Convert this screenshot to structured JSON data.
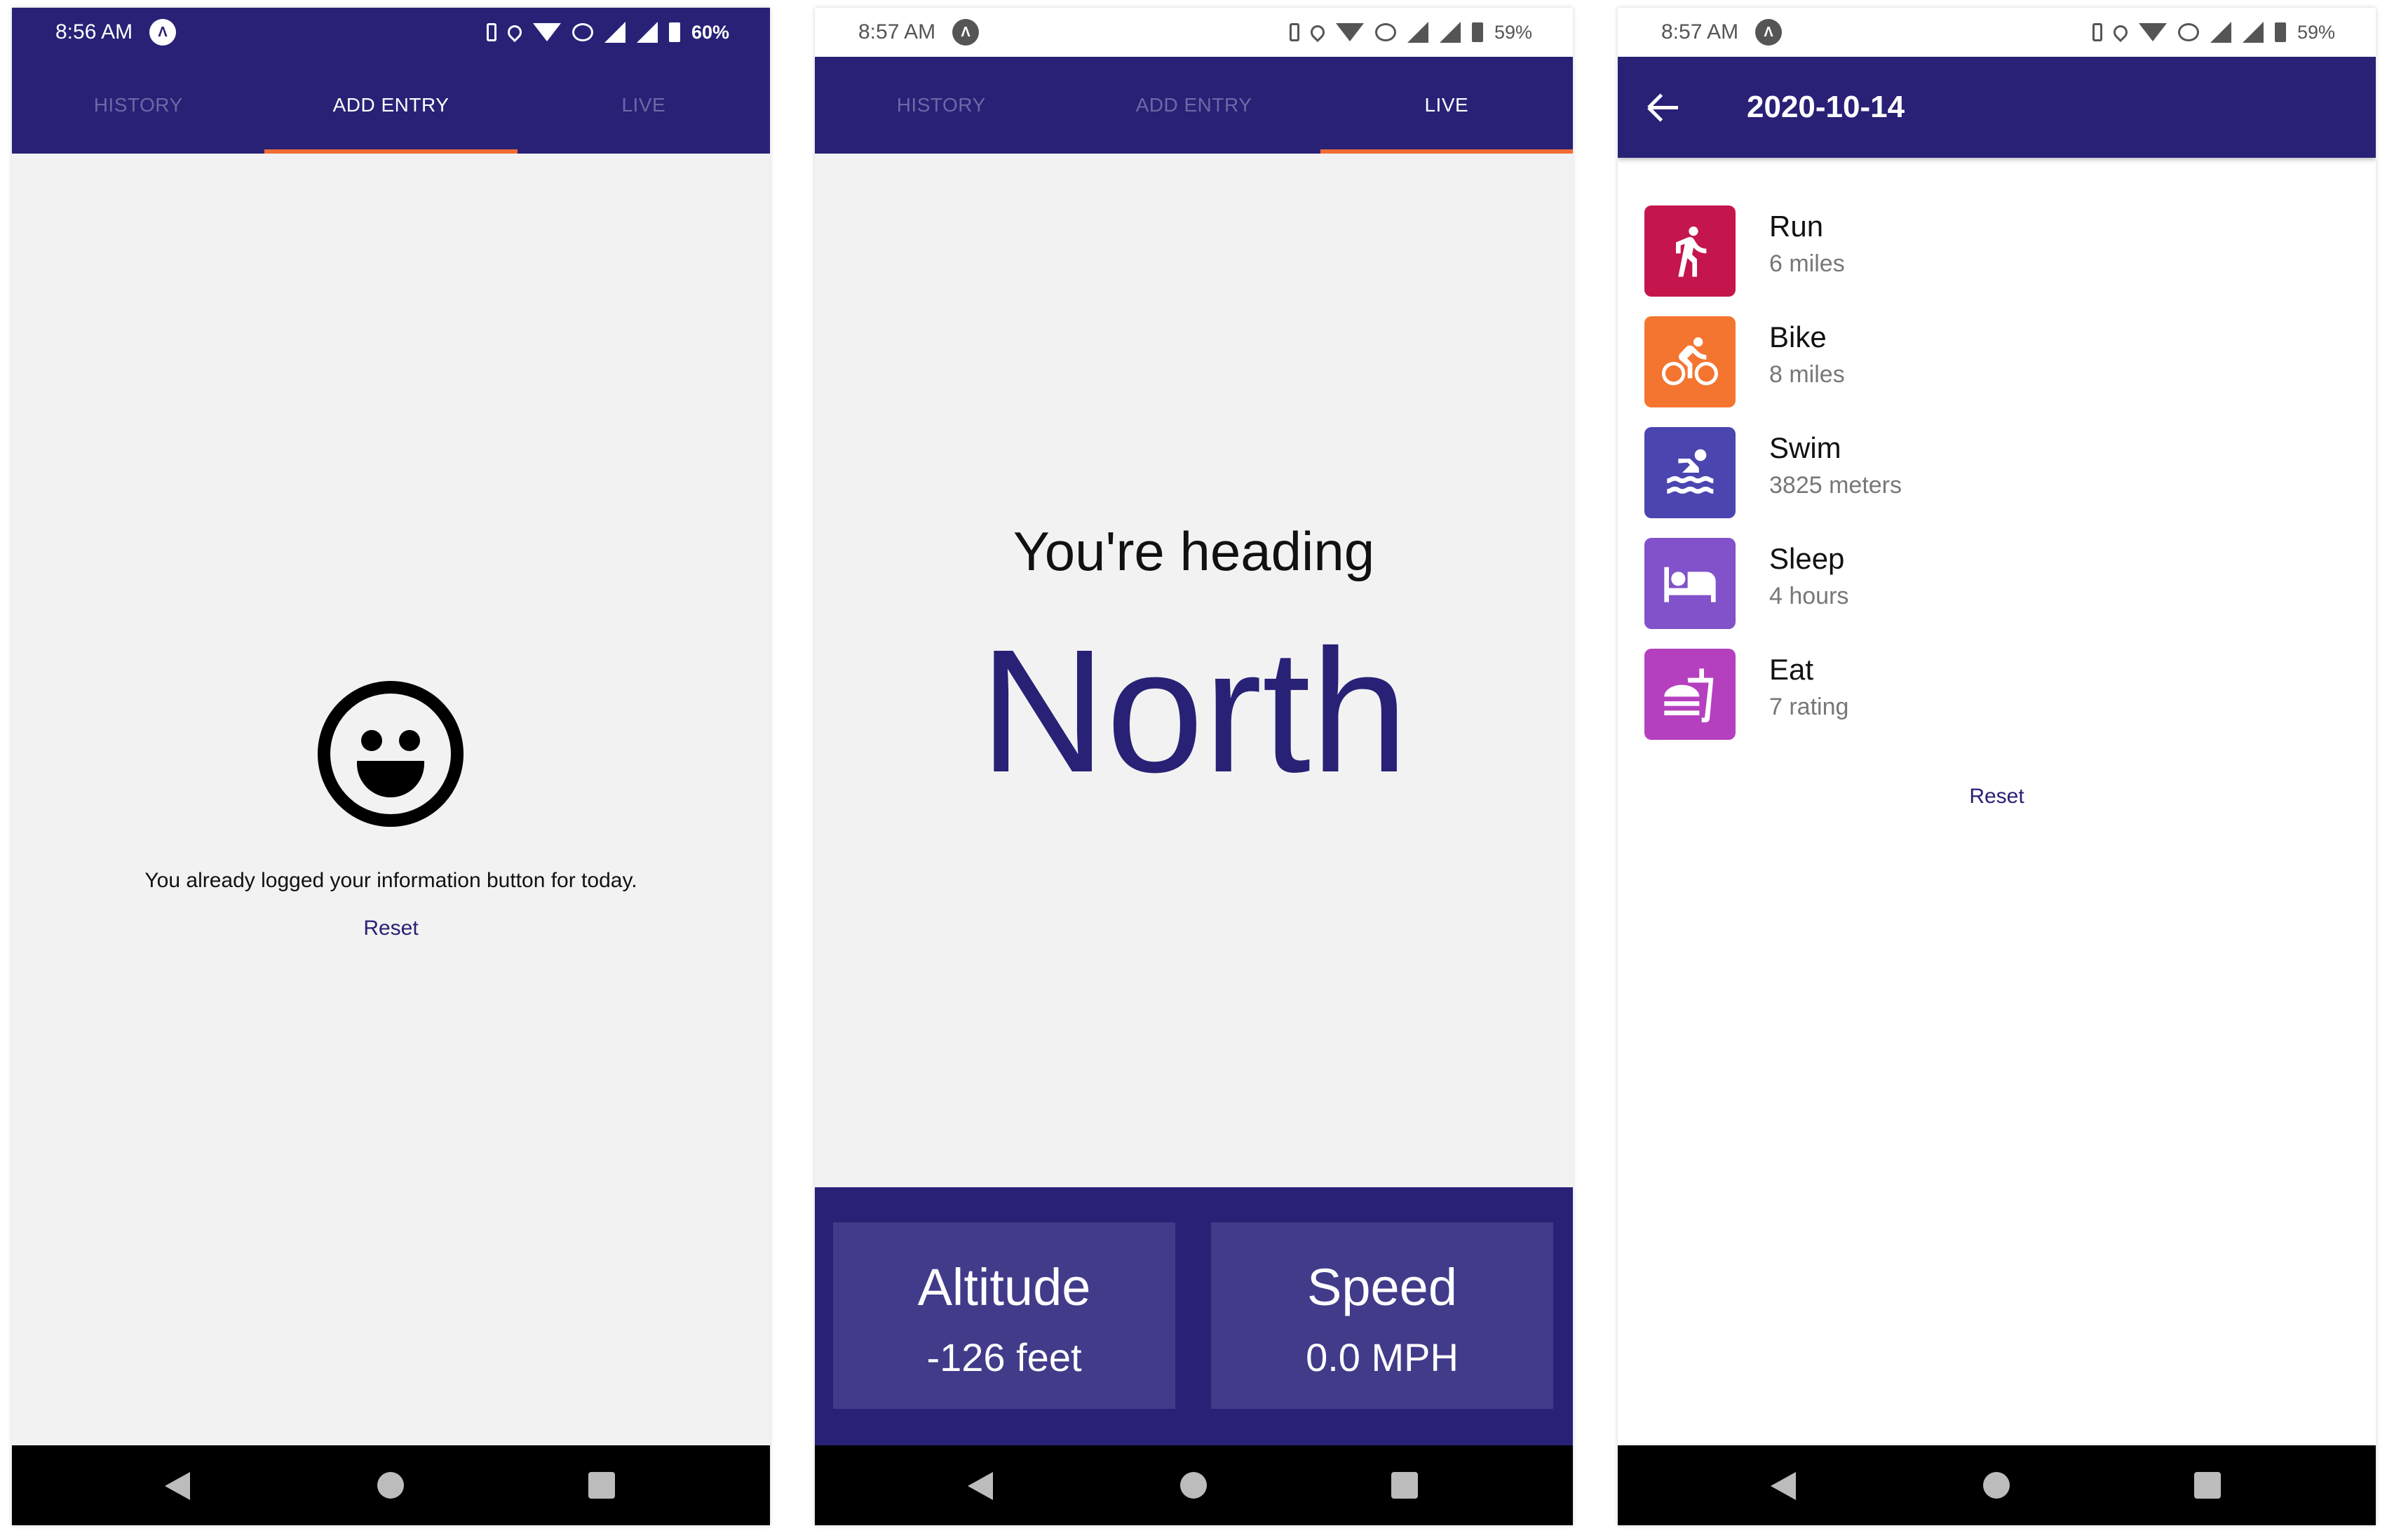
{
  "colors": {
    "primary": "#282176",
    "accent": "#f26d32",
    "card": "#413b8a"
  },
  "screens": [
    {
      "status": {
        "time": "8:56 AM",
        "battery": "60%"
      },
      "tabs": [
        {
          "label": "HISTORY",
          "active": false
        },
        {
          "label": "ADD ENTRY",
          "active": true
        },
        {
          "label": "LIVE",
          "active": false
        }
      ],
      "message": "You already logged your information button for today.",
      "reset": "Reset"
    },
    {
      "status": {
        "time": "8:57 AM",
        "battery": "59%"
      },
      "tabs": [
        {
          "label": "HISTORY",
          "active": false
        },
        {
          "label": "ADD ENTRY",
          "active": false
        },
        {
          "label": "LIVE",
          "active": true
        }
      ],
      "heading_label": "You're heading",
      "heading_value": "North",
      "altitude": {
        "title": "Altitude",
        "value": "-126 feet"
      },
      "speed": {
        "title": "Speed",
        "value": "0.0 MPH"
      }
    },
    {
      "status": {
        "time": "8:57 AM",
        "battery": "59%"
      },
      "title": "2020-10-14",
      "activities": [
        {
          "name": "Run",
          "value": "6 miles",
          "color": "#c4164c",
          "icon": "run-icon"
        },
        {
          "name": "Bike",
          "value": "8 miles",
          "color": "#f47530",
          "icon": "bike-icon"
        },
        {
          "name": "Swim",
          "value": "3825 meters",
          "color": "#4b45b0",
          "icon": "swim-icon"
        },
        {
          "name": "Sleep",
          "value": "4 hours",
          "color": "#8152c9",
          "icon": "bed-icon"
        },
        {
          "name": "Eat",
          "value": "7 rating",
          "color": "#b540bf",
          "icon": "food-icon"
        }
      ],
      "reset": "Reset"
    }
  ]
}
